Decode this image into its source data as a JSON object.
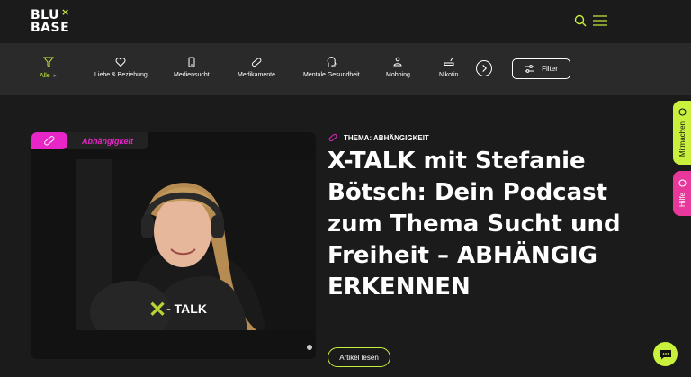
{
  "header": {
    "logo_line1": "BLU",
    "logo_line2": "BASE",
    "logo_x": "×"
  },
  "categories": [
    {
      "label": "Alle",
      "icon": "filter-icon",
      "active": true
    },
    {
      "label": "Liebe & Beziehung",
      "icon": "heart-icon",
      "active": false
    },
    {
      "label": "Mediensucht",
      "icon": "phone-icon",
      "active": false
    },
    {
      "label": "Medikamente",
      "icon": "pill-icon",
      "active": false
    },
    {
      "label": "Mentale Gesundheit",
      "icon": "head-icon",
      "active": false
    },
    {
      "label": "Mobbing",
      "icon": "mobbing-icon",
      "active": false
    },
    {
      "label": "Nikotin",
      "icon": "cigarette-icon",
      "active": false
    }
  ],
  "filter": {
    "label": "Filter"
  },
  "article": {
    "tag": "Abhängigkeit",
    "theme": "THEMA: ABHÄNGIGKEIT",
    "title": "X-TALK mit Stefanie Bötsch: Dein Podcast zum Thema Sucht und Freiheit – ABHÄNGIG ERKENNEN",
    "read_more": "Artikel lesen",
    "video_overlay": "- TALK",
    "video_overlay_x": "✕"
  },
  "side": {
    "mitmachen": "Mitmachen",
    "hilfe": "Hilfe"
  },
  "colors": {
    "accent": "#c8f03c",
    "pink": "#e825c6",
    "background": "#1b1b1b"
  }
}
